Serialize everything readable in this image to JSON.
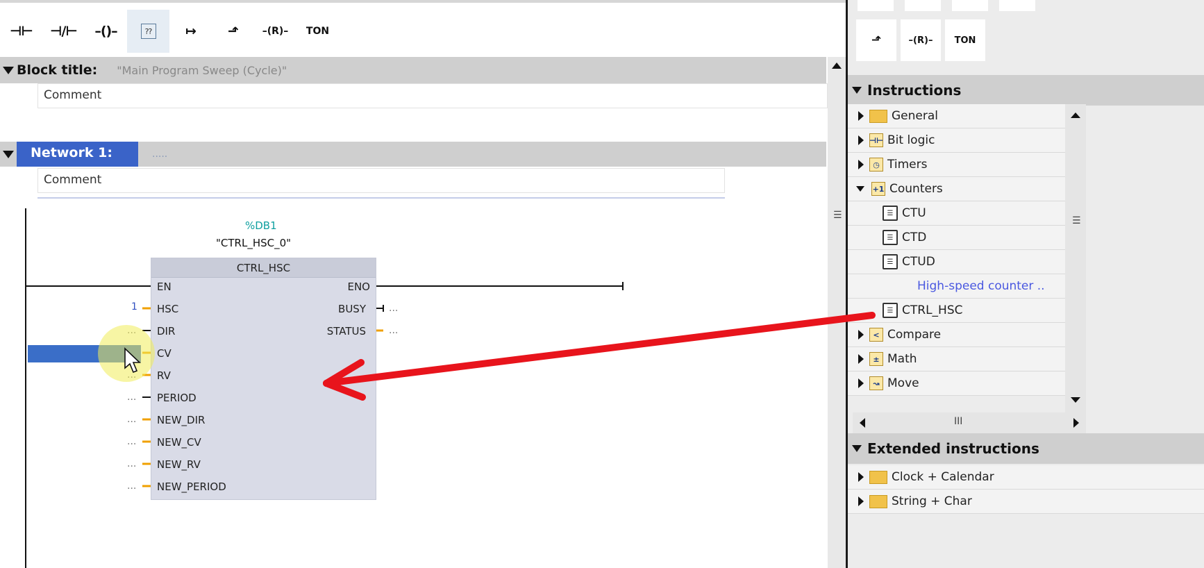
{
  "toolbar": {
    "tools": [
      {
        "name": "no-contact-button",
        "glyph": "⊣⊢"
      },
      {
        "name": "nc-contact-button",
        "glyph": "⊣/⊢"
      },
      {
        "name": "coil-button",
        "glyph": "–()–"
      },
      {
        "name": "empty-box-button",
        "glyph": "??"
      },
      {
        "name": "open-branch-button",
        "glyph": "↦"
      },
      {
        "name": "close-branch-button",
        "glyph": "⬏"
      },
      {
        "name": "reset-coil-button",
        "glyph": "–(R)–"
      },
      {
        "name": "ton-button",
        "glyph": "TON"
      }
    ]
  },
  "block": {
    "title_label": "Block title:",
    "title_value": "\"Main Program Sweep (Cycle)\"",
    "comment": "Comment"
  },
  "network": {
    "label": "Network 1:",
    "dots": ".....",
    "comment": "Comment"
  },
  "instance": {
    "db": "%DB1",
    "name": "\"CTRL_HSC_0\"",
    "type": "CTRL_HSC"
  },
  "pins": {
    "inputs": [
      {
        "name": "EN",
        "value": ""
      },
      {
        "name": "HSC",
        "value": "1"
      },
      {
        "name": "DIR",
        "value": "..."
      },
      {
        "name": "CV",
        "value": ""
      },
      {
        "name": "RV",
        "value": "..."
      },
      {
        "name": "PERIOD",
        "value": "..."
      },
      {
        "name": "NEW_DIR",
        "value": "..."
      },
      {
        "name": "NEW_CV",
        "value": "..."
      },
      {
        "name": "NEW_RV",
        "value": "..."
      },
      {
        "name": "NEW_PERIOD",
        "value": "..."
      }
    ],
    "outputs": [
      {
        "name": "ENO",
        "value": ""
      },
      {
        "name": "BUSY",
        "value": "..."
      },
      {
        "name": "STATUS",
        "value": "..."
      }
    ]
  },
  "right_panel": {
    "toolbar": [
      "⬏",
      "–(R)–",
      "TON"
    ],
    "instructions_title": "Instructions",
    "extended_title": "Extended instructions",
    "hscroll_grip": "III",
    "tree": [
      {
        "label": "General",
        "icon": "folder-icon",
        "expanded": false
      },
      {
        "label": "Bit logic",
        "icon": "bit-logic-icon",
        "expanded": false
      },
      {
        "label": "Timers",
        "icon": "timers-icon",
        "expanded": false
      },
      {
        "label": "Counters",
        "icon": "counters-icon",
        "expanded": true
      },
      {
        "label": "CTU",
        "icon": "function-block-icon",
        "child": true
      },
      {
        "label": "CTD",
        "icon": "function-block-icon",
        "child": true
      },
      {
        "label": "CTUD",
        "icon": "function-block-icon",
        "child": true
      },
      {
        "label": "High-speed counter ..",
        "icon": "",
        "child": true,
        "link": true
      },
      {
        "label": "CTRL_HSC",
        "icon": "function-block-icon",
        "child": true
      },
      {
        "label": "Compare",
        "icon": "compare-icon",
        "expanded": false
      },
      {
        "label": "Math",
        "icon": "math-icon",
        "expanded": false
      },
      {
        "label": "Move",
        "icon": "move-icon",
        "expanded": false
      }
    ],
    "extended": [
      {
        "label": "Clock + Calendar",
        "icon": "folder-icon"
      },
      {
        "label": "String + Char",
        "icon": "folder-icon"
      }
    ]
  },
  "colors": {
    "network_label_bg": "#3a63c8",
    "wire_orange": "#f0a000",
    "arrow_red": "#e8141c",
    "db_teal": "#10a0a0",
    "link_blue": "#4a58e0"
  }
}
